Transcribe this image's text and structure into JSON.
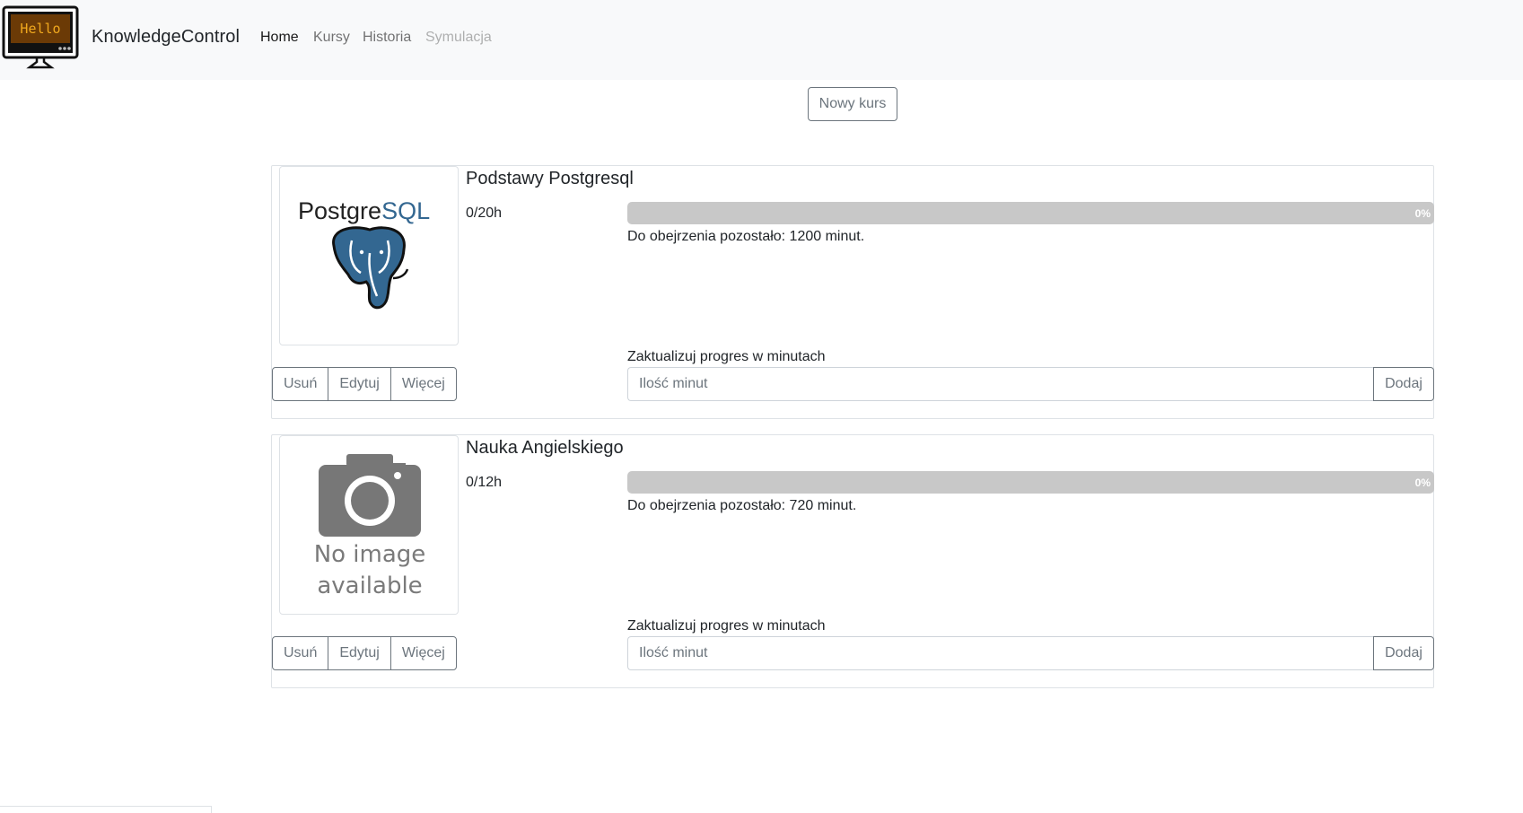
{
  "navbar": {
    "logo_text": "Hello",
    "brand": "KnowledgeControl",
    "links": [
      {
        "label": "Home",
        "state": "active"
      },
      {
        "label": "Kursy",
        "state": "normal"
      },
      {
        "label": "Historia",
        "state": "normal"
      },
      {
        "label": "Symulacja",
        "state": "disabled"
      }
    ]
  },
  "new_course_label": "Nowy kurs",
  "courses": [
    {
      "title": "Podstawy Postgresql",
      "hours": "0/20h",
      "progress_percent": 0,
      "progress_label": "0%",
      "remaining": "Do obejrzenia pozostało: 1200 minut.",
      "update_label": "Zaktualizuj progres w minutach",
      "input_placeholder": "Ilość minut",
      "add_label": "Dodaj",
      "actions": [
        "Usuń",
        "Edytuj",
        "Więcej"
      ],
      "image": {
        "kind": "postgresql-logo",
        "logo_text_dark": "Postgre",
        "logo_text_blue": "SQL"
      }
    },
    {
      "title": "Nauka Angielskiego",
      "hours": "0/12h",
      "progress_percent": 0,
      "progress_label": "0%",
      "remaining": "Do obejrzenia pozostało: 720 minut.",
      "update_label": "Zaktualizuj progres w minutach",
      "input_placeholder": "Ilość minut",
      "add_label": "Dodaj",
      "actions": [
        "Usuń",
        "Edytuj",
        "Więcej"
      ],
      "image": {
        "kind": "no-image-placeholder",
        "line1": "No image",
        "line2": "available"
      }
    }
  ],
  "colors": {
    "navbar_bg": "#f8f9fa",
    "progress_track": "#c8c8c8",
    "postgres_blue": "#336791",
    "button_outline": "#6c757d"
  }
}
